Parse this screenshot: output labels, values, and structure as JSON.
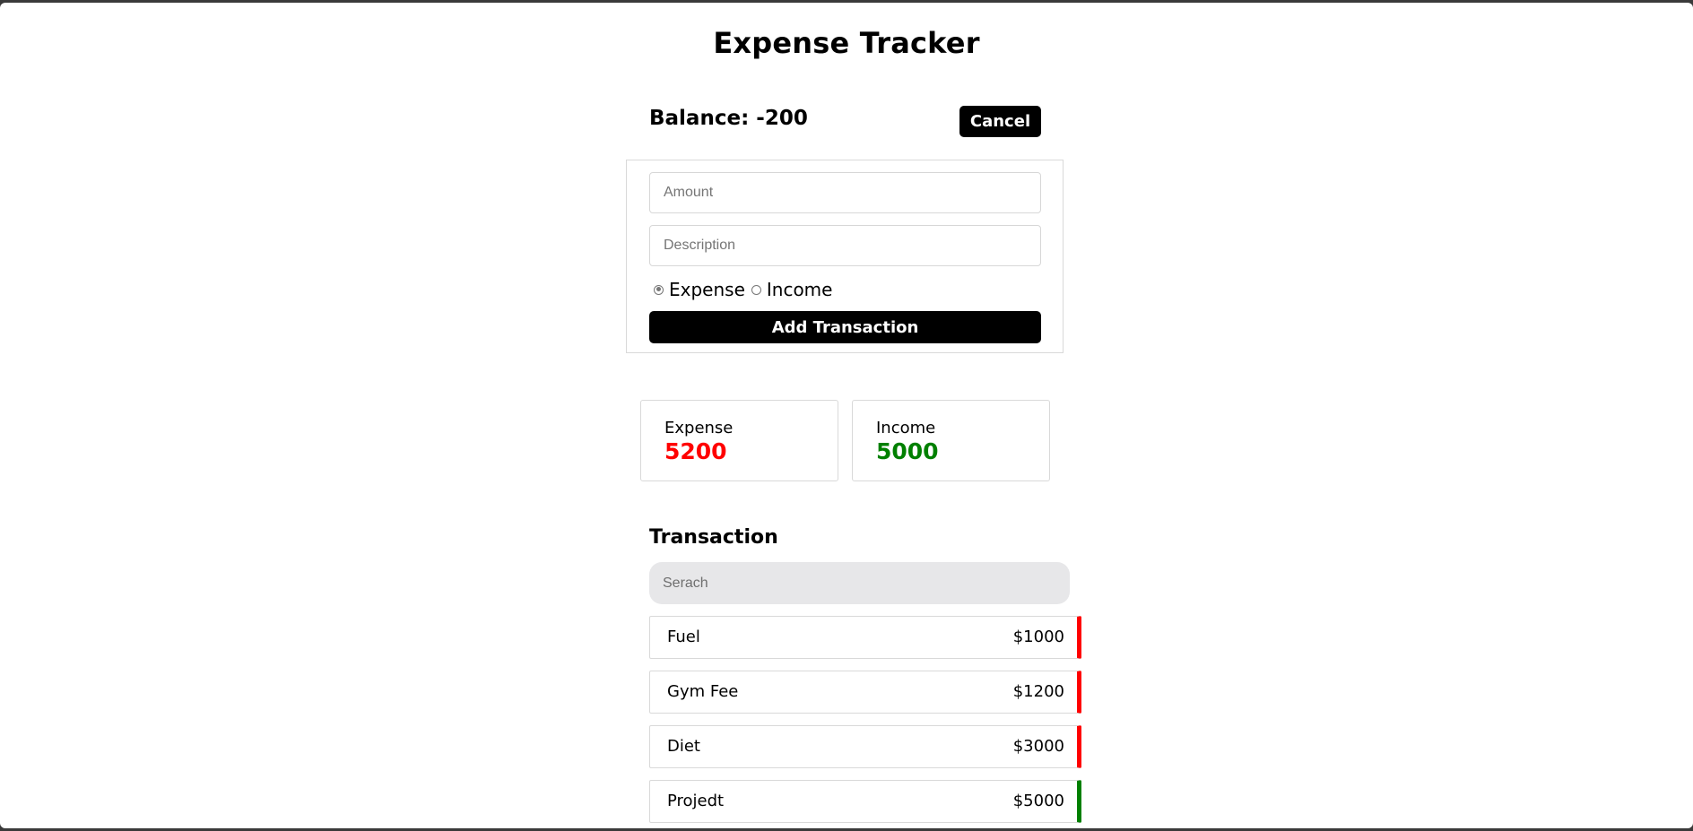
{
  "app": {
    "title": "Expense Tracker"
  },
  "balance": {
    "text": "Balance: -200"
  },
  "header": {
    "cancel_label": "Cancel"
  },
  "form": {
    "amount_placeholder": "Amount",
    "amount_value": "",
    "description_placeholder": "Description",
    "description_value": "",
    "type_options": [
      "Expense",
      "Income"
    ],
    "type_selected": "Expense",
    "submit_label": "Add Transaction"
  },
  "summary": {
    "expense_label": "Expense",
    "expense_value": "5200",
    "income_label": "Income",
    "income_value": "5000"
  },
  "transactions": {
    "title": "Transaction",
    "search_placeholder": "Serach",
    "search_value": "",
    "items": [
      {
        "description": "Fuel",
        "amount": "$1000",
        "type": "expense"
      },
      {
        "description": "Gym Fee",
        "amount": "$1200",
        "type": "expense"
      },
      {
        "description": "Diet",
        "amount": "$3000",
        "type": "expense"
      },
      {
        "description": "Projedt",
        "amount": "$5000",
        "type": "income"
      }
    ]
  },
  "colors": {
    "expense": "#ff0000",
    "income": "#008000",
    "button_bg": "#000000",
    "search_bg": "#e7e7e9"
  }
}
